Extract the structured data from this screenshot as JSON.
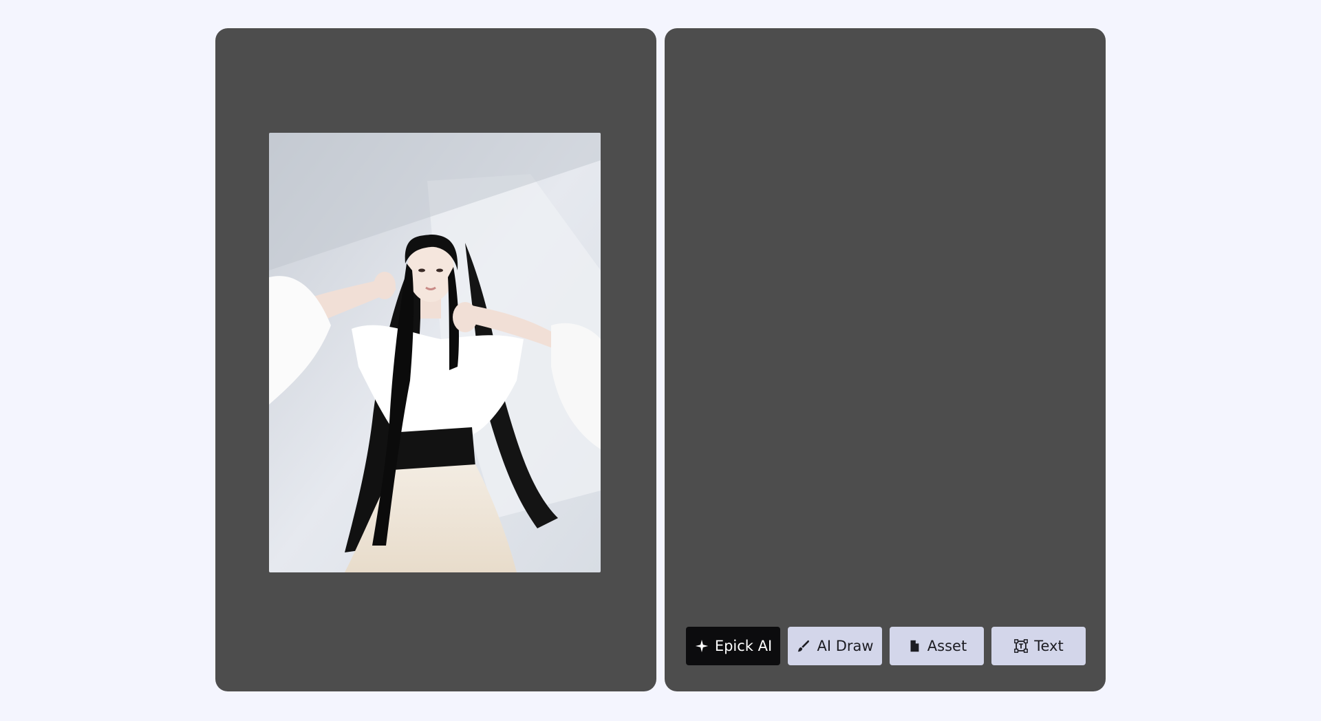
{
  "toolbar": {
    "buttons": [
      {
        "label": "Epick AI",
        "icon": "sparkle-icon",
        "active": true
      },
      {
        "label": "AI Draw",
        "icon": "brush-icon",
        "active": false
      },
      {
        "label": "Asset",
        "icon": "document-icon",
        "active": false
      },
      {
        "label": "Text",
        "icon": "text-frame-icon",
        "active": false
      }
    ]
  },
  "colors": {
    "page_background": "#f4f5fe",
    "panel_background": "#4d4d4d",
    "primary_button": "#0c0c0e",
    "secondary_button": "#d3d6ea"
  }
}
